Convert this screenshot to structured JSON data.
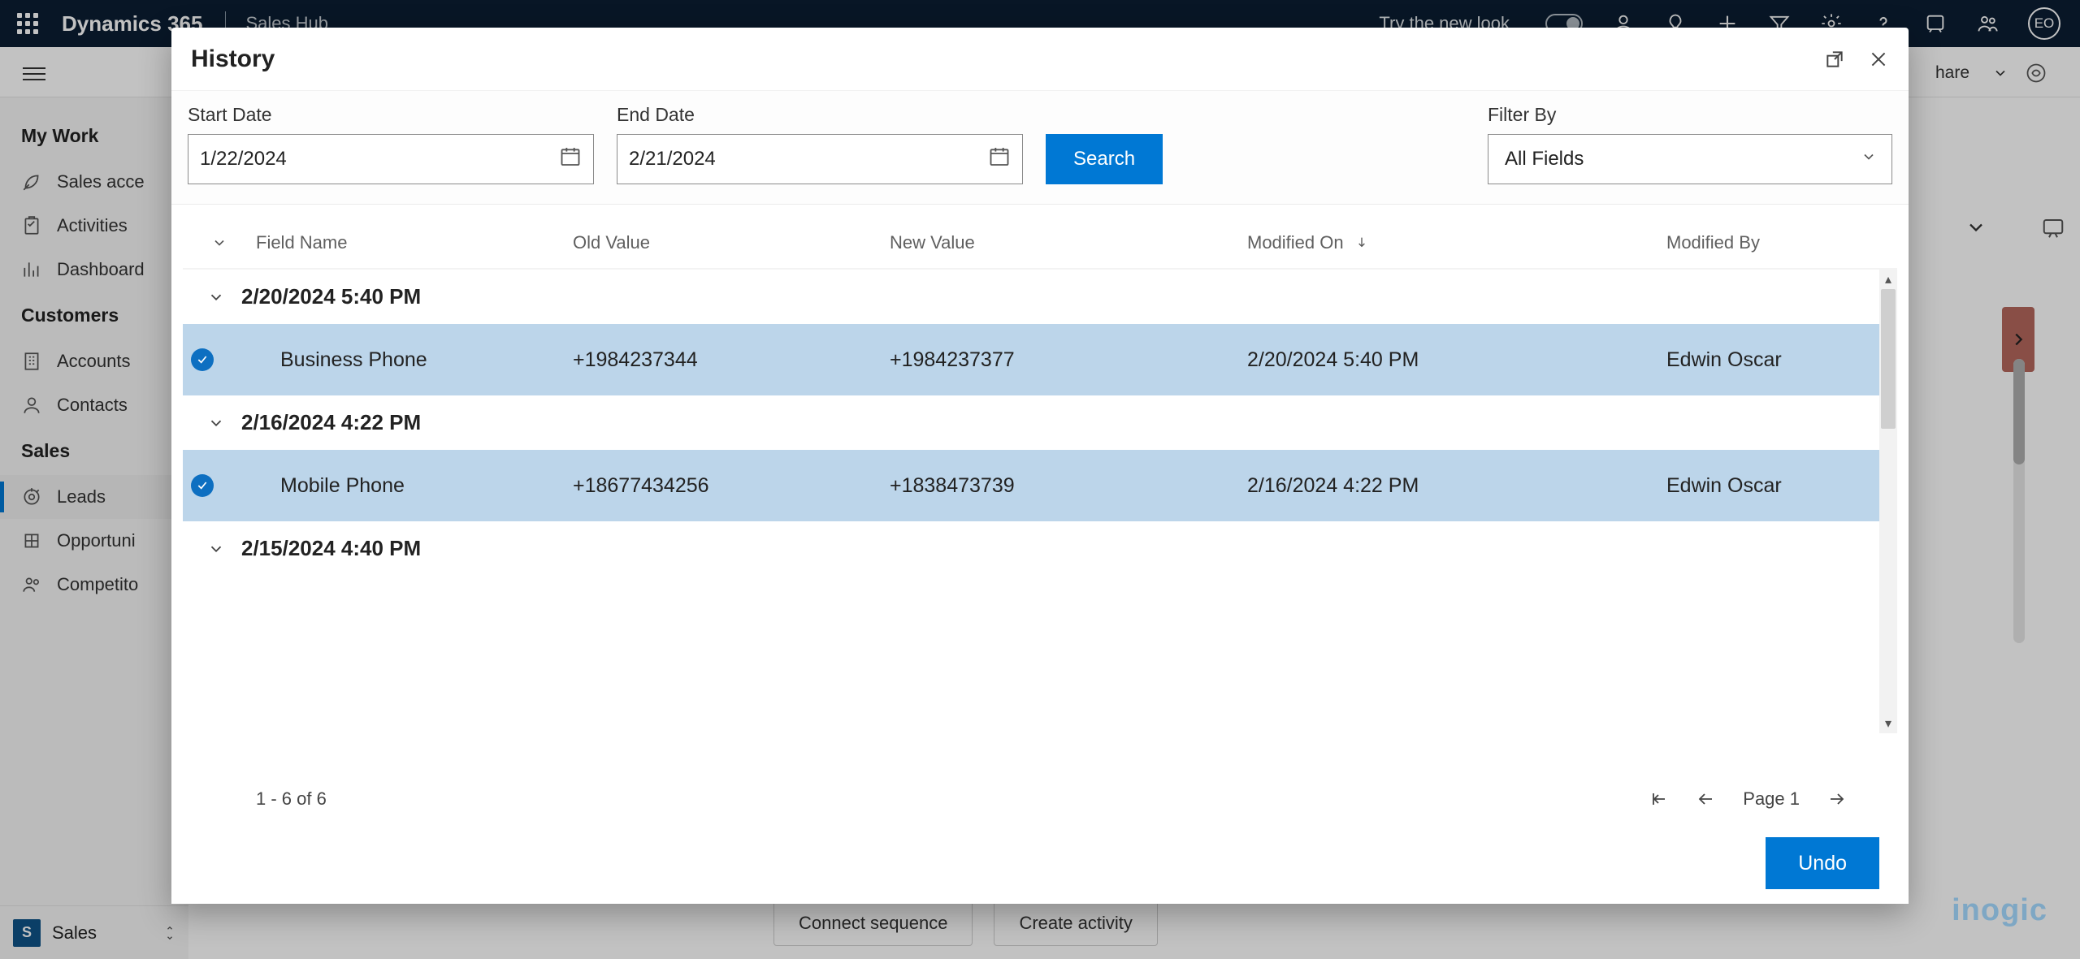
{
  "topbar": {
    "brand": "Dynamics 365",
    "app_name": "Sales Hub",
    "try_new_look": "Try the new look",
    "avatar_initials": "EO"
  },
  "secondbar": {
    "share": "hare"
  },
  "nav": {
    "section_mywork": "My Work",
    "sales_accelerator": "Sales acce",
    "activities": "Activities",
    "dashboards": "Dashboard",
    "section_customers": "Customers",
    "accounts": "Accounts",
    "contacts": "Contacts",
    "section_sales": "Sales",
    "leads": "Leads",
    "opportunities": "Opportuni",
    "competitors": "Competito",
    "footer_badge": "S",
    "footer_label": "Sales"
  },
  "bg": {
    "connect_sequence": "Connect sequence",
    "create_activity": "Create activity"
  },
  "dialog": {
    "title": "History",
    "start_date_label": "Start Date",
    "start_date": "1/22/2024",
    "end_date_label": "End Date",
    "end_date": "2/21/2024",
    "search_btn": "Search",
    "filter_by_label": "Filter By",
    "filter_by_value": "All Fields",
    "columns": {
      "field_name": "Field Name",
      "old_value": "Old Value",
      "new_value": "New Value",
      "modified_on": "Modified On",
      "modified_by": "Modified By"
    },
    "groups": [
      {
        "header": "2/20/2024 5:40 PM",
        "rows": [
          {
            "field": "Business Phone",
            "old": "+1984237344",
            "new": "+1984237377",
            "modon": "2/20/2024 5:40 PM",
            "modby": "Edwin Oscar"
          }
        ]
      },
      {
        "header": "2/16/2024 4:22 PM",
        "rows": [
          {
            "field": "Mobile Phone",
            "old": "+18677434256",
            "new": "+1838473739",
            "modon": "2/16/2024 4:22 PM",
            "modby": "Edwin Oscar"
          }
        ]
      },
      {
        "header": "2/15/2024 4:40 PM",
        "rows": []
      }
    ],
    "pager": {
      "range": "1 - 6 of 6",
      "page": "Page 1"
    },
    "undo": "Undo"
  },
  "watermark": "inogic"
}
